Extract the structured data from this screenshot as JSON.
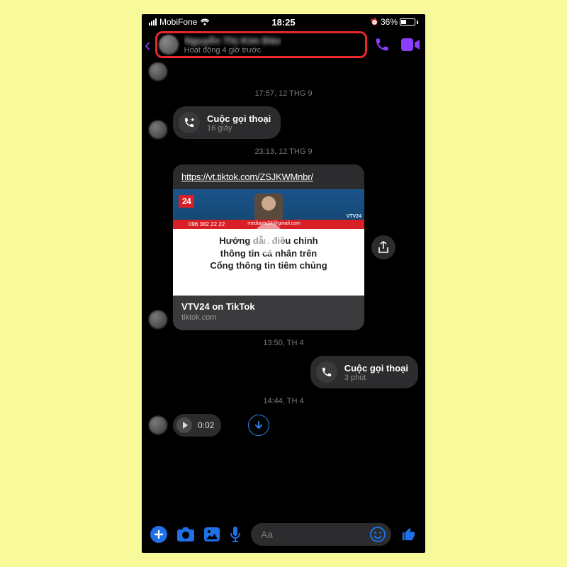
{
  "status": {
    "carrier": "MobiFone",
    "time": "18:25",
    "battery_pct": "36%"
  },
  "header": {
    "contact_name_hidden": "Nguyễn Thị Kim Đào",
    "activity": "Hoạt động 4 giờ trước"
  },
  "timestamps": {
    "t1": "17:57, 12 THG 9",
    "t2": "23:13, 12 THG 9",
    "t3": "13:50, TH 4",
    "t4": "14:44, TH 4"
  },
  "call_incoming": {
    "title": "Cuộc gọi thoại",
    "sub": "16 giây"
  },
  "link": {
    "url": "https://vt.tiktok.com/ZSJKWMnbr/",
    "badge": "24",
    "strip_phone": "096 382 22 22",
    "strip_mail": "mediavtv24@gmail.com",
    "strip_tag": "VTV24",
    "h1": "Hướng dẫn điều chỉnh",
    "h2": "thông tin cá nhân trên",
    "h3": "Cổng thông tin tiêm chủng",
    "meta_title": "VTV24 on TikTok",
    "meta_domain": "tiktok.com"
  },
  "call_outgoing": {
    "title": "Cuộc gọi thoại",
    "sub": "3 phút"
  },
  "voice": {
    "time": "0:02"
  },
  "composer": {
    "placeholder": "Aa"
  }
}
